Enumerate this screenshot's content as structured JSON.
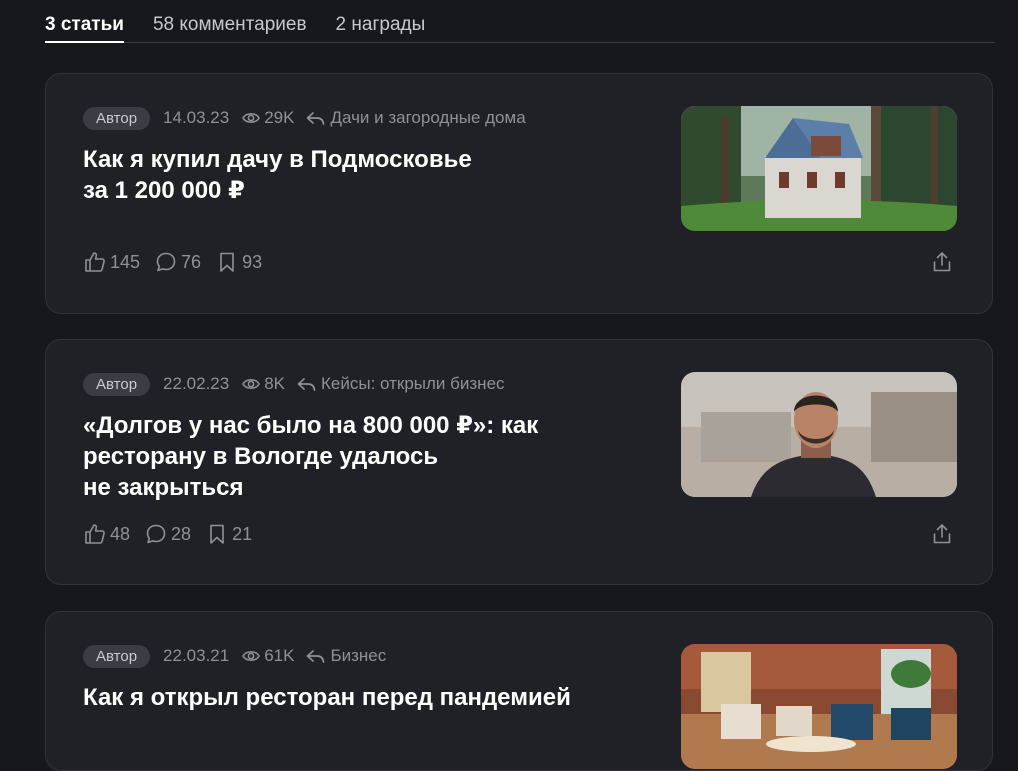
{
  "tabs": [
    {
      "label": "3 статьи",
      "active": true
    },
    {
      "label": "58 комментариев",
      "active": false
    },
    {
      "label": "2 награды",
      "active": false
    }
  ],
  "articles": [
    {
      "badge": "Автор",
      "date": "14.03.23",
      "views": "29K",
      "category": "Дачи и загородные дома",
      "title_lines": [
        "Как я купил дачу в Подмосковье",
        "за 1 200 000 ₽"
      ],
      "likes": "145",
      "comments": "76",
      "bookmarks": "93",
      "image_icon": "country-house-photo"
    },
    {
      "badge": "Автор",
      "date": "22.02.23",
      "views": "8K",
      "category": "Кейсы: открыли бизнес",
      "title_lines": [
        "«Долгов у нас было на 800 000 ₽»: как",
        "ресторану в Вологде удалось",
        "не закрыться"
      ],
      "likes": "48",
      "comments": "28",
      "bookmarks": "21",
      "image_icon": "man-portrait-photo"
    },
    {
      "badge": "Автор",
      "date": "22.03.21",
      "views": "61K",
      "category": "Бизнес",
      "title_lines": [
        "Как я открыл ресторан перед пандемией"
      ],
      "image_icon": "restaurant-interior-photo"
    }
  ],
  "icons": {
    "views": "eye-icon",
    "category": "reply-arrow-icon",
    "likes": "thumbs-up-icon",
    "comments": "comment-bubble-icon",
    "bookmarks": "bookmark-icon",
    "share": "share-icon"
  },
  "colors": {
    "background": "#16181d",
    "card": "#1f2127",
    "muted_text": "#8f9197",
    "title": "#ffffff"
  }
}
